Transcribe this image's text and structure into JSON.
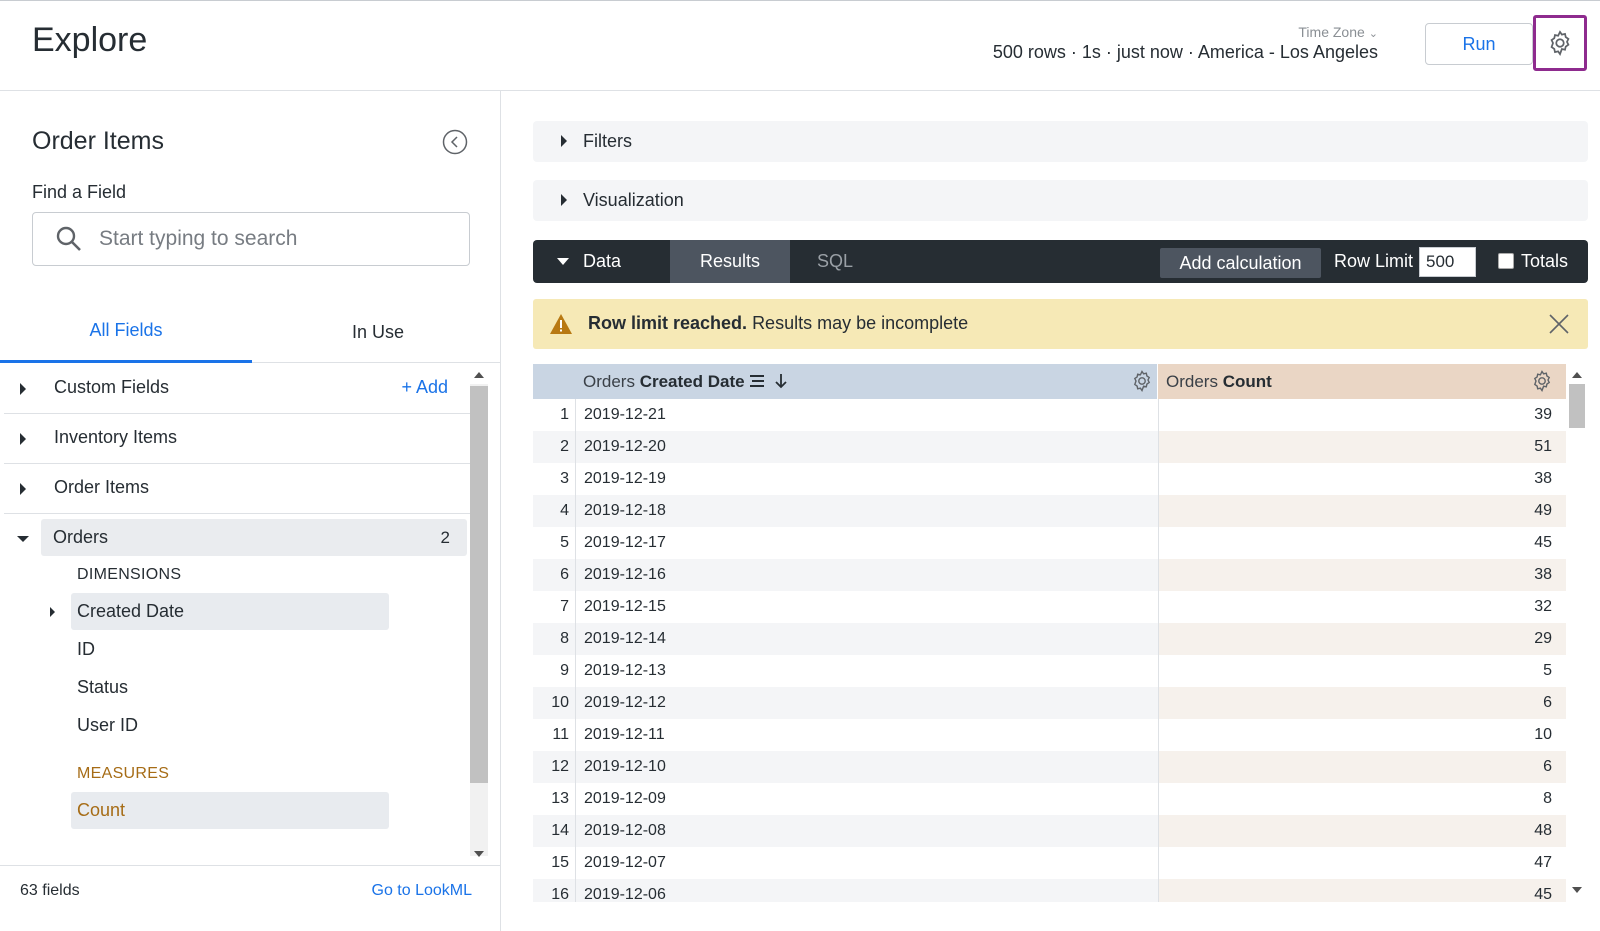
{
  "header": {
    "title": "Explore",
    "time_zone_label": "Time Zone",
    "run_info": "500 rows · 1s · just now · America - Los Angeles",
    "run_label": "Run",
    "settings_icon": "gear-icon",
    "highlight_color": "#8e2b8e"
  },
  "sidebar": {
    "explore_name": "Order Items",
    "find_label": "Find a Field",
    "search_placeholder": "Start typing to search",
    "tabs": [
      {
        "label": "All Fields",
        "active": true
      },
      {
        "label": "In Use",
        "active": false
      }
    ],
    "views": [
      {
        "label": "Custom Fields",
        "action": "+ Add"
      },
      {
        "label": "Inventory Items"
      },
      {
        "label": "Order Items"
      }
    ],
    "orders": {
      "label": "Orders",
      "count": "2",
      "dimensions_label": "DIMENSIONS",
      "dimensions": [
        "Created Date",
        "ID",
        "Status",
        "User ID"
      ],
      "measures_label": "MEASURES",
      "measures": [
        "Count"
      ]
    },
    "footer": {
      "field_count": "63 fields",
      "goto_lookml": "Go to LookML"
    }
  },
  "sections": {
    "filters": "Filters",
    "visualization": "Visualization"
  },
  "data_bar": {
    "label": "Data",
    "tabs": [
      "Results",
      "SQL"
    ],
    "add_calculation": "Add calculation",
    "row_limit_label": "Row Limit",
    "row_limit_value": "500",
    "totals_label": "Totals"
  },
  "warning": {
    "bold": "Row limit reached.",
    "text": "Results may be incomplete"
  },
  "results": {
    "dim_header_view": "Orders",
    "dim_header_field": "Created Date",
    "measure_header_view": "Orders",
    "measure_header_field": "Count",
    "rows": [
      {
        "n": "1",
        "date": "2019-12-21",
        "count": "39"
      },
      {
        "n": "2",
        "date": "2019-12-20",
        "count": "51"
      },
      {
        "n": "3",
        "date": "2019-12-19",
        "count": "38"
      },
      {
        "n": "4",
        "date": "2019-12-18",
        "count": "49"
      },
      {
        "n": "5",
        "date": "2019-12-17",
        "count": "45"
      },
      {
        "n": "6",
        "date": "2019-12-16",
        "count": "38"
      },
      {
        "n": "7",
        "date": "2019-12-15",
        "count": "32"
      },
      {
        "n": "8",
        "date": "2019-12-14",
        "count": "29"
      },
      {
        "n": "9",
        "date": "2019-12-13",
        "count": "5"
      },
      {
        "n": "10",
        "date": "2019-12-12",
        "count": "6"
      },
      {
        "n": "11",
        "date": "2019-12-11",
        "count": "10"
      },
      {
        "n": "12",
        "date": "2019-12-10",
        "count": "6"
      },
      {
        "n": "13",
        "date": "2019-12-09",
        "count": "8"
      },
      {
        "n": "14",
        "date": "2019-12-08",
        "count": "48"
      },
      {
        "n": "15",
        "date": "2019-12-07",
        "count": "47"
      },
      {
        "n": "16",
        "date": "2019-12-06",
        "count": "45"
      }
    ]
  }
}
